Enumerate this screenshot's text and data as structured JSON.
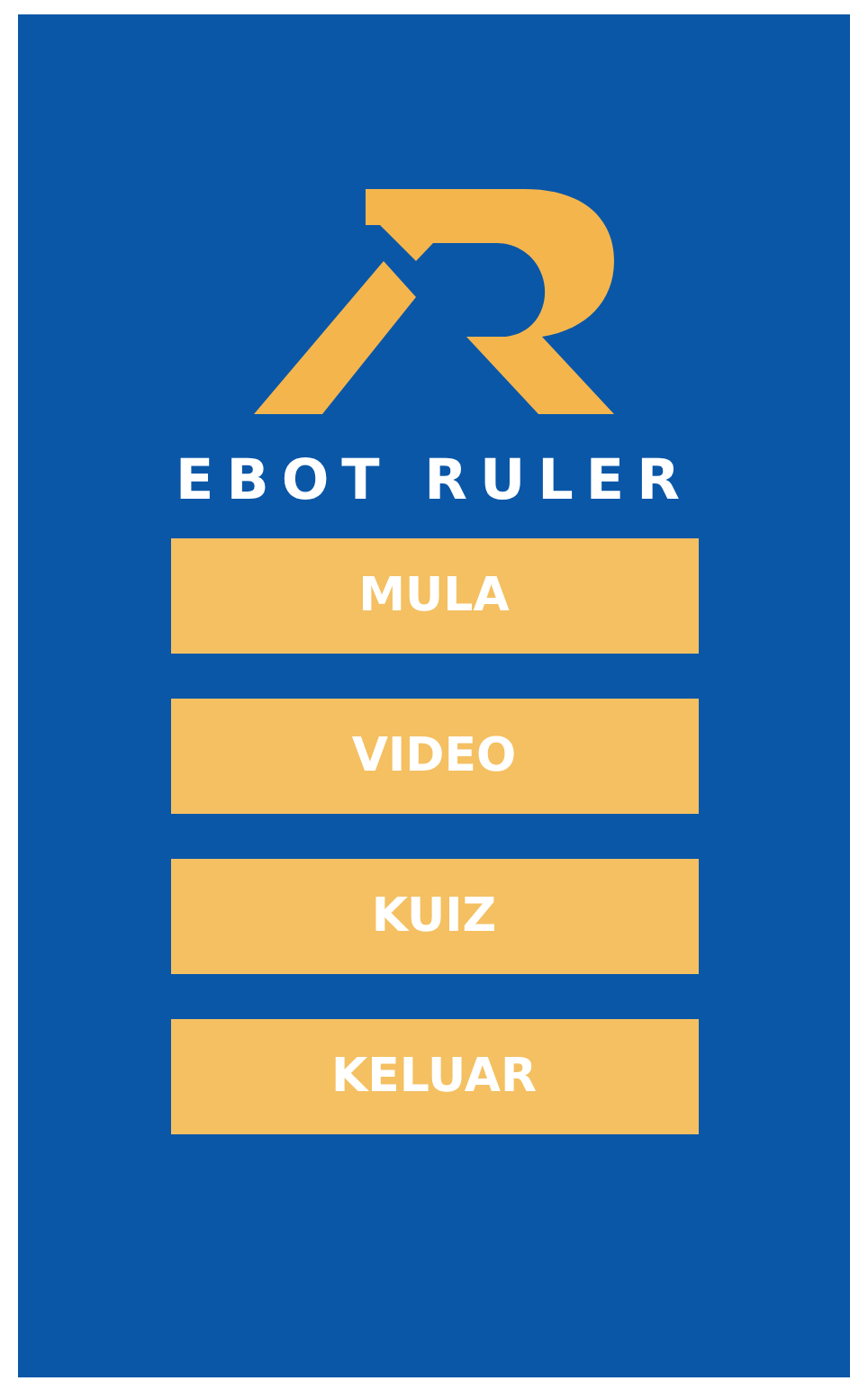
{
  "app": {
    "title": "EBOT RULER"
  },
  "menu": [
    {
      "label": "MULA"
    },
    {
      "label": "VIDEO"
    },
    {
      "label": "KUIZ"
    },
    {
      "label": "KELUAR"
    }
  ]
}
